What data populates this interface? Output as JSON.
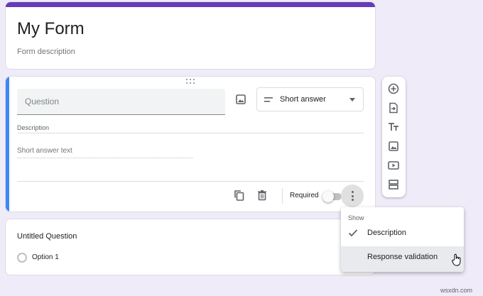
{
  "header": {
    "title": "My Form",
    "description_placeholder": "Form description",
    "accent_color": "#673ab7"
  },
  "active_question": {
    "title_placeholder": "Question",
    "type_selected": "Short answer",
    "description_label": "Description",
    "answer_placeholder": "Short answer text",
    "required_label": "Required",
    "required": false,
    "accent_color": "#4285f4",
    "icons": [
      "drag-handle-icon",
      "image-icon",
      "short-answer-icon",
      "dropdown-caret-icon",
      "copy-icon",
      "trash-icon",
      "more-vert-icon"
    ]
  },
  "second_question": {
    "title": "Untitled Question",
    "option_label": "Option 1"
  },
  "toolbar": {
    "items": [
      "add-question-icon",
      "import-questions-icon",
      "add-title-icon",
      "add-image-icon",
      "add-video-icon",
      "add-section-icon"
    ]
  },
  "menu": {
    "header": "Show",
    "items": [
      {
        "label": "Description",
        "checked": true
      },
      {
        "label": "Response validation",
        "checked": false
      }
    ]
  },
  "watermark": "wsxdn.com"
}
